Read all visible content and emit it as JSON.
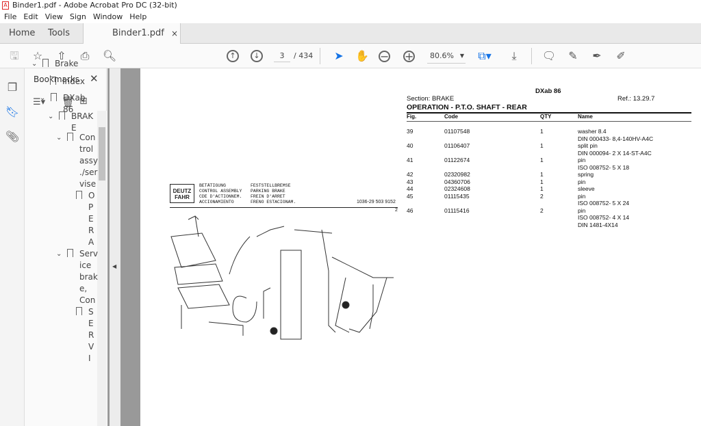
{
  "window": {
    "title": "Binder1.pdf - Adobe Acrobat Pro DC (32-bit)"
  },
  "menu": [
    "File",
    "Edit",
    "View",
    "Sign",
    "Window",
    "Help"
  ],
  "tabs": {
    "home": "Home",
    "tools": "Tools",
    "doc": "Binder1.pdf",
    "close": "×"
  },
  "toolbar": {
    "page_current": "3",
    "page_total": "/ 434",
    "zoom": "80.6%"
  },
  "bookmarks": {
    "title": "Bookmarks",
    "items": [
      {
        "label": "Brake",
        "lines": [
          "Brake"
        ]
      },
      {
        "label": "Index",
        "lines": [
          "Index"
        ]
      },
      {
        "label": "DXab 86",
        "lines": [
          "DXab 86"
        ]
      },
      {
        "label": "BRAKE",
        "lines": [
          "BRAK",
          "E"
        ]
      },
      {
        "label": "Control assy./servise",
        "lines": [
          "Con",
          "trol",
          "assy",
          "./ser",
          "vise"
        ]
      },
      {
        "label": "OPERA",
        "lines": [
          "O",
          "P",
          "E",
          "R",
          "A"
        ]
      },
      {
        "label": "Service brake, Con",
        "lines": [
          "Serv",
          "ice",
          "brak",
          "e,",
          "Con"
        ]
      },
      {
        "label": "SERVI",
        "lines": [
          "S",
          "E",
          "R",
          "V",
          "I"
        ]
      }
    ]
  },
  "doc": {
    "model": "DXab 86",
    "section": "Section: BRAKE",
    "ref": "Ref.: 13.29.7",
    "heading": "OPERATION - P.T.O. SHAFT - REAR",
    "columns": [
      "Fig.",
      "Code",
      "QTY",
      "Name"
    ],
    "rows": [
      {
        "fig": "39",
        "code": "01107548",
        "qty": "1",
        "name": [
          "washer 8.4",
          "DIN 000433- 8,4-140HV-A4C"
        ]
      },
      {
        "fig": "40",
        "code": "01106407",
        "qty": "1",
        "name": [
          "split pin",
          "DIN 000094- 2 X 14-ST-A4C"
        ]
      },
      {
        "fig": "41",
        "code": "01122674",
        "qty": "1",
        "name": [
          "pin",
          "ISO 008752- 5 X 18"
        ]
      },
      {
        "fig": "42",
        "code": "02320982",
        "qty": "1",
        "name": [
          "spring"
        ]
      },
      {
        "fig": "43",
        "code": "04360706",
        "qty": "1",
        "name": [
          "pin"
        ]
      },
      {
        "fig": "44",
        "code": "02324608",
        "qty": "1",
        "name": [
          "sleeve"
        ]
      },
      {
        "fig": "45",
        "code": "01115435",
        "qty": "2",
        "name": [
          "pin",
          "ISO 008752- 5 X 24"
        ]
      },
      {
        "fig": "46",
        "code": "01115416",
        "qty": "2",
        "name": [
          "pin",
          "ISO 008752- 4 X 14",
          "DIN 1481-4X14"
        ]
      }
    ],
    "diagram": {
      "logo": "DEUTZ FAHR",
      "col1": [
        "BETÄTIGUNG",
        "CONTROL ASSEMBLY",
        "CDE D'ACTIONNEM.",
        "ACCIONAMIENTO"
      ],
      "col2": [
        "FESTSTELLBREMSE",
        "PARKING BRAKE",
        "FREIN D'ARRET",
        "FRENO ESTACIONAM."
      ],
      "number": "1036-29 503 9152",
      "page": "2"
    }
  }
}
